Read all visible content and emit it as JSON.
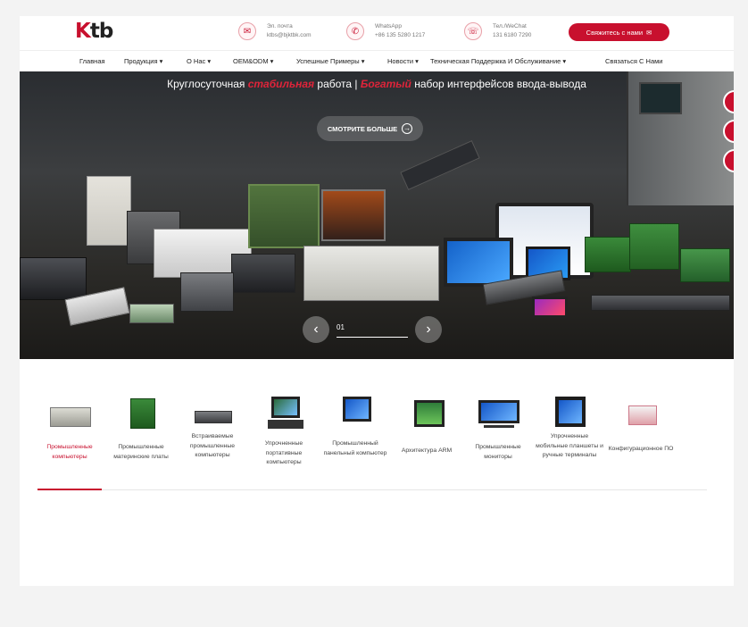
{
  "header": {
    "logo_text": "Ktb",
    "email": {
      "label": "Эл. почта",
      "value": "ktbs@bjktbk.com"
    },
    "whatsapp": {
      "label": "WhatsApp",
      "value": "+86 135 5280 1217"
    },
    "tel": {
      "label": "Тел./WeChat",
      "value": "131 6180 7290"
    },
    "cta_label": "Свяжитесь с нами"
  },
  "nav": {
    "items": [
      "Главная",
      "Продукция ▾",
      "О Нас ▾",
      "OEM&ODM ▾",
      "Успешные Примеры ▾",
      "Новости ▾",
      "Техническая Поддержка И Обслуживание ▾",
      "Связаться С Нами"
    ]
  },
  "hero": {
    "tagline_part1": "Круглосуточная ",
    "tagline_red1": "стабильная",
    "tagline_part2": " работа  |  ",
    "tagline_red2": "Богатый",
    "tagline_part3": " набор интерфейсов ввода-вывода",
    "see_more": "СМОТРИТЕ БОЛЬШЕ",
    "slide_number": "01",
    "prev_icon": "‹",
    "next_icon": "›"
  },
  "categories": [
    "Промышленные компьютеры",
    "Промышленные материнские платы",
    "Встраиваемые промышленные компьютеры",
    "Упрочненные портативные компьютеры",
    "Промышленный панельный компьютер",
    "Архитектура ARM",
    "Промышленные мониторы",
    "Упрочненные мобильные планшеты и ручные терминалы",
    "Конфигурационное ПО"
  ],
  "active_category": 0,
  "colors": {
    "accent": "#c8102e"
  }
}
